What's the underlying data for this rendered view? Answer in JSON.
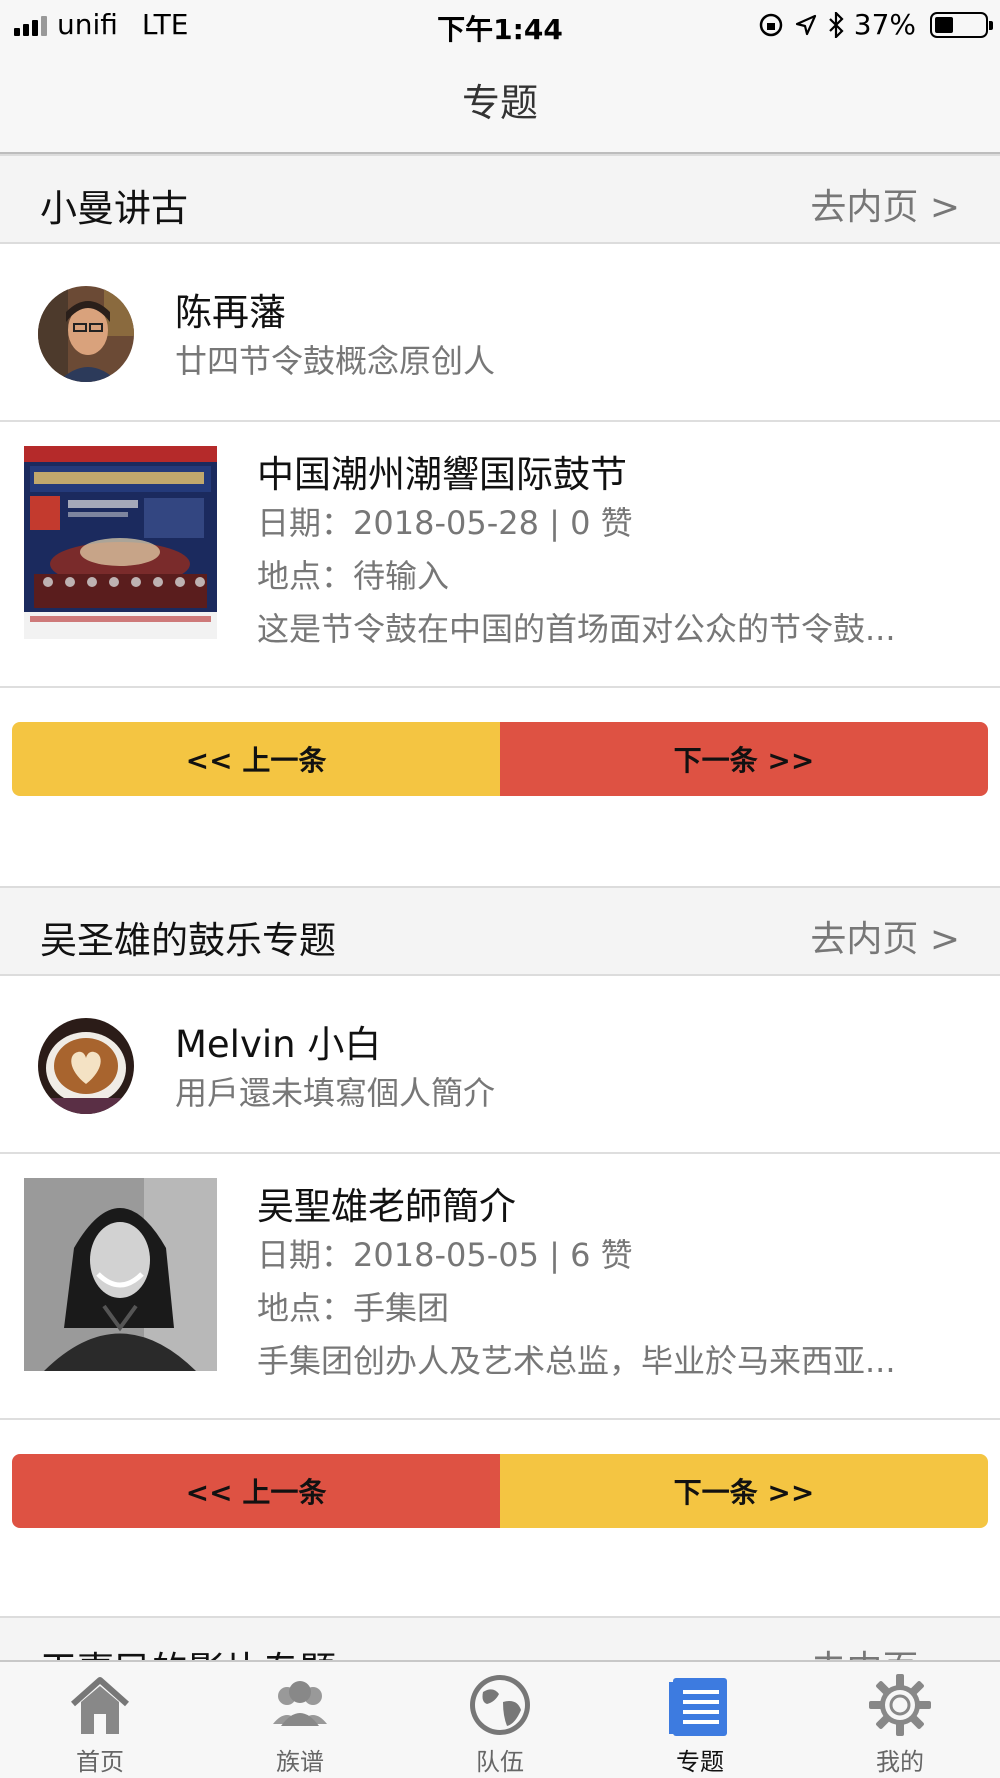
{
  "status_bar": {
    "carrier": "unifi",
    "network": "LTE",
    "time": "下午1:44",
    "battery": "37%",
    "battery_level": 0.37
  },
  "nav": {
    "title": "专题"
  },
  "colors": {
    "yellow": "#f4c542",
    "red": "#de5243",
    "active_tab": "#3d7be0"
  },
  "sections": [
    {
      "title": "小曼讲古",
      "link": "去内页 >",
      "author": {
        "name": "陈再藩",
        "bio": "廿四节令鼓概念原创人",
        "avatar_icon": "person-photo"
      },
      "item": {
        "title": "中国潮州潮響国际鼓节",
        "date_line": "日期：2018-05-28 | 0 赞",
        "place_line": "地点：待输入",
        "desc": "这是节令鼓在中国的首场面对公众的节令鼓...",
        "thumb_icon": "festival-poster"
      },
      "prev_label": "<< 上一条",
      "next_label": "下一条 >>",
      "prev_color": "yellow",
      "next_color": "red"
    },
    {
      "title": "吴圣雄的鼓乐专题",
      "link": "去内页 >",
      "author": {
        "name": "Melvin 小白",
        "bio": "用戶還未填寫個人簡介",
        "avatar_icon": "coffee-photo"
      },
      "item": {
        "title": "吴聖雄老師簡介",
        "date_line": "日期：2018-05-05 | 6 赞",
        "place_line": "地点：手集团",
        "desc": "手集团创办人及艺术总监，毕业於马来西亚...",
        "thumb_icon": "portrait-photo"
      },
      "prev_label": "<< 上一条",
      "next_label": "下一条 >>",
      "prev_color": "red",
      "next_color": "yellow"
    },
    {
      "title": "王嘉民的影片专题",
      "link": "去内页 >"
    }
  ],
  "tabs": [
    {
      "label": "首页",
      "icon": "home-icon"
    },
    {
      "label": "族谱",
      "icon": "people-icon"
    },
    {
      "label": "队伍",
      "icon": "globe-icon"
    },
    {
      "label": "专题",
      "icon": "document-icon",
      "active": true
    },
    {
      "label": "我的",
      "icon": "gear-icon"
    }
  ]
}
